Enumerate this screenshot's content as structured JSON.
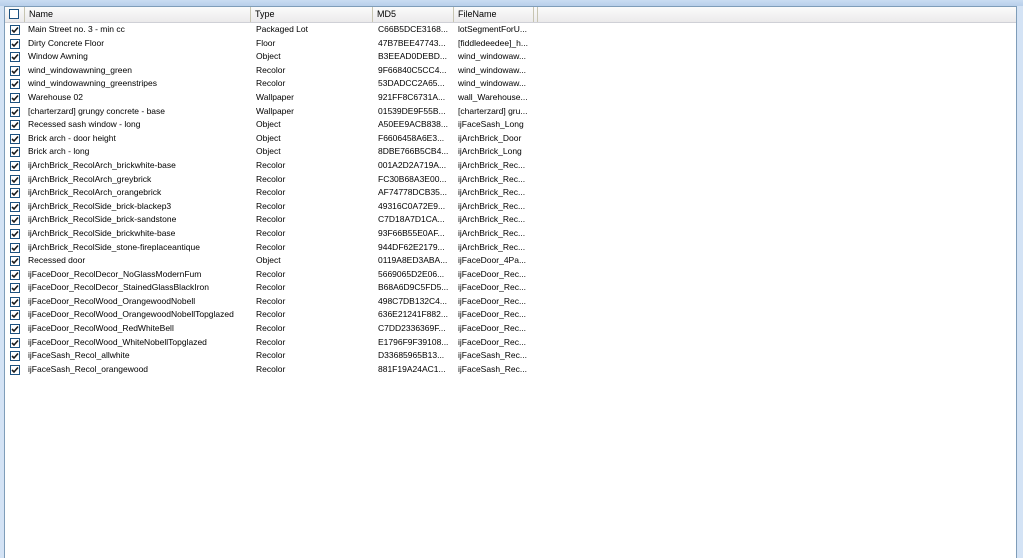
{
  "columns": {
    "name": "Name",
    "type": "Type",
    "md5": "MD5",
    "filename": "FileName"
  },
  "rows": [
    {
      "name": "Main Street no. 3 - min cc",
      "type": "Packaged Lot",
      "md5": "C66B5DCE3168...",
      "filename": "lotSegmentForU...",
      "checked": true
    },
    {
      "name": "Dirty Concrete Floor",
      "type": "Floor",
      "md5": "47B7BEE47743...",
      "filename": "[fiddledeedee]_h...",
      "checked": true
    },
    {
      "name": "Window Awning",
      "type": "Object",
      "md5": "B3EEAD0DEBD...",
      "filename": "wind_windowaw...",
      "checked": true
    },
    {
      "name": "wind_windowawning_green",
      "type": "Recolor",
      "md5": "9F66840C5CC4...",
      "filename": "wind_windowaw...",
      "checked": true
    },
    {
      "name": "wind_windowawning_greenstripes",
      "type": "Recolor",
      "md5": "53DADCC2A65...",
      "filename": "wind_windowaw...",
      "checked": true
    },
    {
      "name": "Warehouse 02",
      "type": "Wallpaper",
      "md5": "921FF8C6731A...",
      "filename": "wall_Warehouse...",
      "checked": true
    },
    {
      "name": "[charterzard] grungy concrete - base",
      "type": "Wallpaper",
      "md5": "01539DE9F55B...",
      "filename": "[charterzard] gru...",
      "checked": true
    },
    {
      "name": "Recessed sash window - long",
      "type": "Object",
      "md5": "A50EE9ACB838...",
      "filename": "ijFaceSash_Long",
      "checked": true
    },
    {
      "name": "Brick arch - door height",
      "type": "Object",
      "md5": "F6606458A6E3...",
      "filename": "ijArchBrick_Door",
      "checked": true
    },
    {
      "name": "Brick arch - long",
      "type": "Object",
      "md5": "8DBE766B5CB4...",
      "filename": "ijArchBrick_Long",
      "checked": true
    },
    {
      "name": "ijArchBrick_RecolArch_brickwhite-base",
      "type": "Recolor",
      "md5": "001A2D2A719A...",
      "filename": "ijArchBrick_Rec...",
      "checked": true
    },
    {
      "name": "ijArchBrick_RecolArch_greybrick",
      "type": "Recolor",
      "md5": "FC30B68A3E00...",
      "filename": "ijArchBrick_Rec...",
      "checked": true
    },
    {
      "name": "ijArchBrick_RecolArch_orangebrick",
      "type": "Recolor",
      "md5": "AF74778DCB35...",
      "filename": "ijArchBrick_Rec...",
      "checked": true
    },
    {
      "name": "ijArchBrick_RecolSide_brick-blackep3",
      "type": "Recolor",
      "md5": "49316C0A72E9...",
      "filename": "ijArchBrick_Rec...",
      "checked": true
    },
    {
      "name": "ijArchBrick_RecolSide_brick-sandstone",
      "type": "Recolor",
      "md5": "C7D18A7D1CA...",
      "filename": "ijArchBrick_Rec...",
      "checked": true
    },
    {
      "name": "ijArchBrick_RecolSide_brickwhite-base",
      "type": "Recolor",
      "md5": "93F66B55E0AF...",
      "filename": "ijArchBrick_Rec...",
      "checked": true
    },
    {
      "name": "ijArchBrick_RecolSide_stone-fireplaceantique",
      "type": "Recolor",
      "md5": "944DF62E2179...",
      "filename": "ijArchBrick_Rec...",
      "checked": true
    },
    {
      "name": "Recessed door",
      "type": "Object",
      "md5": "0119A8ED3ABA...",
      "filename": "ijFaceDoor_4Pa...",
      "checked": true
    },
    {
      "name": "ijFaceDoor_RecolDecor_NoGlassModernFum",
      "type": "Recolor",
      "md5": "5669065D2E06...",
      "filename": "ijFaceDoor_Rec...",
      "checked": true
    },
    {
      "name": "ijFaceDoor_RecolDecor_StainedGlassBlackIron",
      "type": "Recolor",
      "md5": "B68A6D9C5FD5...",
      "filename": "ijFaceDoor_Rec...",
      "checked": true
    },
    {
      "name": "ijFaceDoor_RecolWood_OrangewoodNobell",
      "type": "Recolor",
      "md5": "498C7DB132C4...",
      "filename": "ijFaceDoor_Rec...",
      "checked": true
    },
    {
      "name": "ijFaceDoor_RecolWood_OrangewoodNobellTopglazed",
      "type": "Recolor",
      "md5": "636E21241F882...",
      "filename": "ijFaceDoor_Rec...",
      "checked": true
    },
    {
      "name": "ijFaceDoor_RecolWood_RedWhiteBell",
      "type": "Recolor",
      "md5": "C7DD2336369F...",
      "filename": "ijFaceDoor_Rec...",
      "checked": true
    },
    {
      "name": "ijFaceDoor_RecolWood_WhiteNobellTopglazed",
      "type": "Recolor",
      "md5": "E1796F9F39108...",
      "filename": "ijFaceDoor_Rec...",
      "checked": true
    },
    {
      "name": "ijFaceSash_Recol_allwhite",
      "type": "Recolor",
      "md5": "D33685965B13...",
      "filename": "ijFaceSash_Rec...",
      "checked": true
    },
    {
      "name": "ijFaceSash_Recol_orangewood",
      "type": "Recolor",
      "md5": "881F19A24AC1...",
      "filename": "ijFaceSash_Rec...",
      "checked": true
    }
  ]
}
